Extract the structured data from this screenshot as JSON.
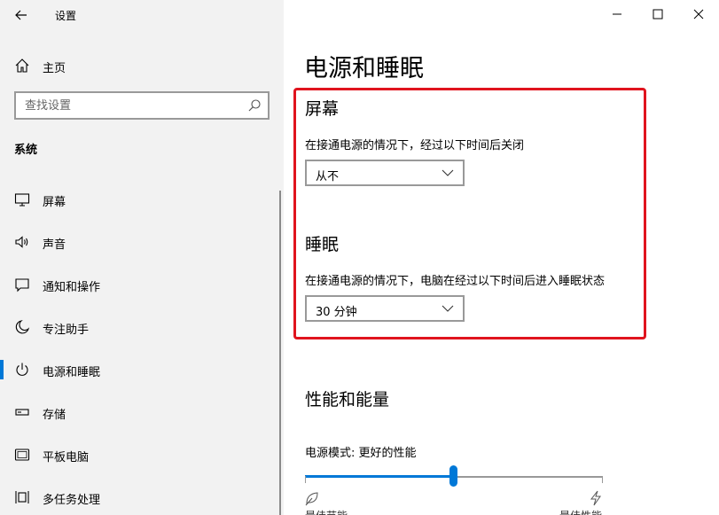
{
  "window": {
    "title": "设置",
    "back_icon": "back-arrow-icon",
    "controls": {
      "minimize": "—",
      "maximize": "☐",
      "close": "✕"
    }
  },
  "sidebar": {
    "home_label": "主页",
    "search_placeholder": "查找设置",
    "section_label": "系统",
    "items": [
      {
        "label": "屏幕",
        "icon": "monitor-icon"
      },
      {
        "label": "声音",
        "icon": "speaker-icon"
      },
      {
        "label": "通知和操作",
        "icon": "notification-icon"
      },
      {
        "label": "专注助手",
        "icon": "moon-icon"
      },
      {
        "label": "电源和睡眠",
        "icon": "power-icon",
        "active": true
      },
      {
        "label": "存储",
        "icon": "storage-icon"
      },
      {
        "label": "平板电脑",
        "icon": "tablet-icon"
      },
      {
        "label": "多任务处理",
        "icon": "multitask-icon"
      }
    ]
  },
  "main": {
    "title": "电源和睡眠",
    "screen": {
      "heading": "屏幕",
      "description": "在接通电源的情况下，经过以下时间后关闭",
      "value": "从不"
    },
    "sleep": {
      "heading": "睡眠",
      "description": "在接通电源的情况下，电脑在经过以下时间后进入睡眠状态",
      "value": "30 分钟"
    },
    "performance": {
      "heading": "性能和能量",
      "mode_label": "电源模式: 更好的性能",
      "slider_value_fraction": 0.5,
      "left_caption": "最佳节能",
      "right_caption": "最佳性能"
    }
  },
  "colors": {
    "accent": "#0078d7",
    "highlight_border": "#e0141e",
    "sidebar_bg": "#f2f2f2"
  }
}
